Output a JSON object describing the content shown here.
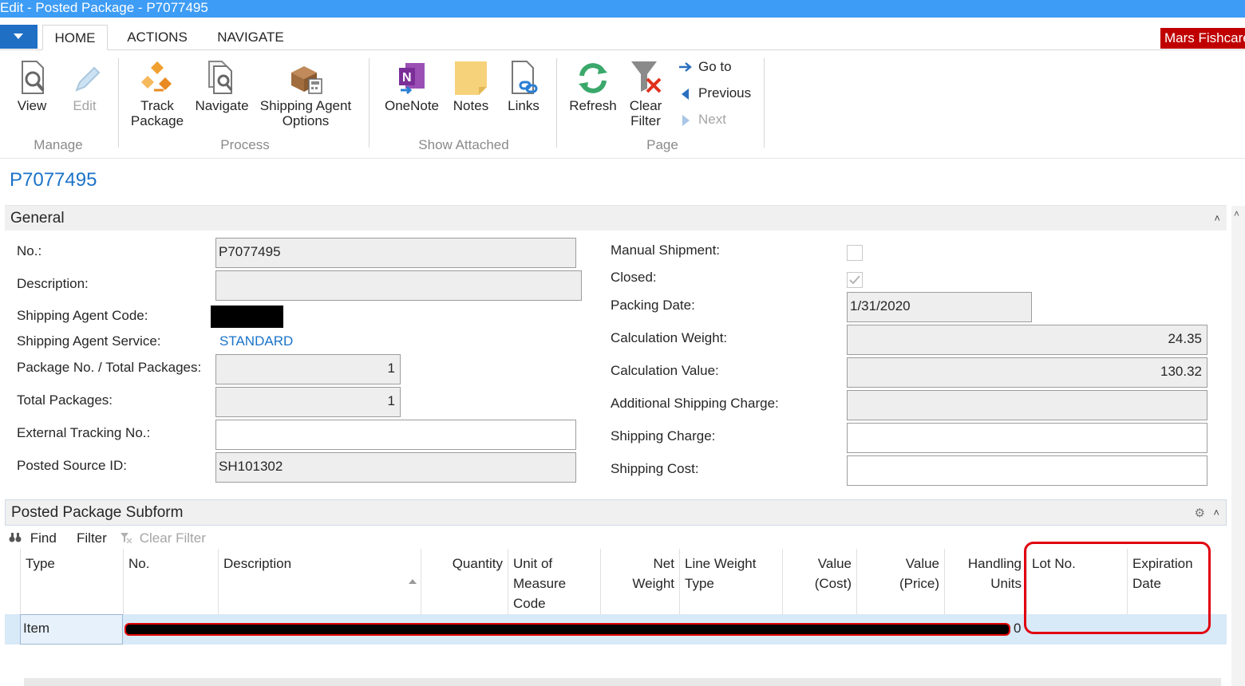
{
  "window": {
    "title": "Edit - Posted Package - P7077495"
  },
  "ribbon_tabs": [
    {
      "label": "HOME"
    },
    {
      "label": "ACTIONS"
    },
    {
      "label": "NAVIGATE"
    }
  ],
  "user": {
    "name": "Mars Fishcare"
  },
  "ribbon": {
    "manage": {
      "label": "Manage",
      "view": "View",
      "edit": "Edit"
    },
    "process": {
      "label": "Process",
      "track_l1": "Track",
      "track_l2": "Package",
      "navigate": "Navigate",
      "shipopt_l1": "Shipping Agent",
      "shipopt_l2": "Options"
    },
    "show_attached": {
      "label": "Show Attached",
      "onenote": "OneNote",
      "notes": "Notes",
      "links": "Links"
    },
    "page": {
      "label": "Page",
      "refresh": "Refresh",
      "clear_l1": "Clear",
      "clear_l2": "Filter",
      "goto": "Go to",
      "previous": "Previous",
      "next": "Next"
    }
  },
  "page_title": "P7077495",
  "general": {
    "header": "General",
    "no_label": "No.:",
    "no_value": "P7077495",
    "description_label": "Description:",
    "description_value": "",
    "agent_code_label": "Shipping Agent Code:",
    "agent_service_label": "Shipping Agent Service:",
    "agent_service_value": "STANDARD",
    "package_no_label": "Package No. / Total Packages:",
    "package_no_value": "1",
    "total_packages_label": "Total Packages:",
    "total_packages_value": "1",
    "external_tracking_label": "External Tracking No.:",
    "external_tracking_value": "",
    "posted_source_label": "Posted Source ID:",
    "posted_source_value": "SH101302",
    "manual_shipment_label": "Manual Shipment:",
    "closed_label": "Closed:",
    "packing_date_label": "Packing Date:",
    "packing_date_value": "1/31/2020",
    "calc_weight_label": "Calculation Weight:",
    "calc_weight_value": "24.35",
    "calc_value_label": "Calculation Value:",
    "calc_value_value": "130.32",
    "add_charge_label": "Additional Shipping Charge:",
    "add_charge_value": "",
    "ship_charge_label": "Shipping Charge:",
    "ship_charge_value": "",
    "ship_cost_label": "Shipping Cost:",
    "ship_cost_value": ""
  },
  "subform": {
    "header": "Posted Package Subform",
    "find": "Find",
    "filter": "Filter",
    "clear_filter": "Clear Filter",
    "columns": [
      {
        "l1": "Type",
        "l2": "",
        "l3": ""
      },
      {
        "l1": "No.",
        "l2": "",
        "l3": ""
      },
      {
        "l1": "Description",
        "l2": "",
        "l3": ""
      },
      {
        "l1": "Quantity",
        "l2": "",
        "l3": ""
      },
      {
        "l1": "Unit of",
        "l2": "Measure",
        "l3": "Code"
      },
      {
        "l1": "Net",
        "l2": "Weight",
        "l3": ""
      },
      {
        "l1": "Line Weight",
        "l2": "Type",
        "l3": ""
      },
      {
        "l1": "Value",
        "l2": "(Cost)",
        "l3": ""
      },
      {
        "l1": "Value",
        "l2": "(Price)",
        "l3": ""
      },
      {
        "l1": "Handling",
        "l2": "Units",
        "l3": ""
      },
      {
        "l1": "Lot No.",
        "l2": "",
        "l3": ""
      },
      {
        "l1": "Expiration",
        "l2": "Date",
        "l3": ""
      }
    ],
    "row": {
      "type": "Item",
      "trailing_value": "0"
    }
  }
}
